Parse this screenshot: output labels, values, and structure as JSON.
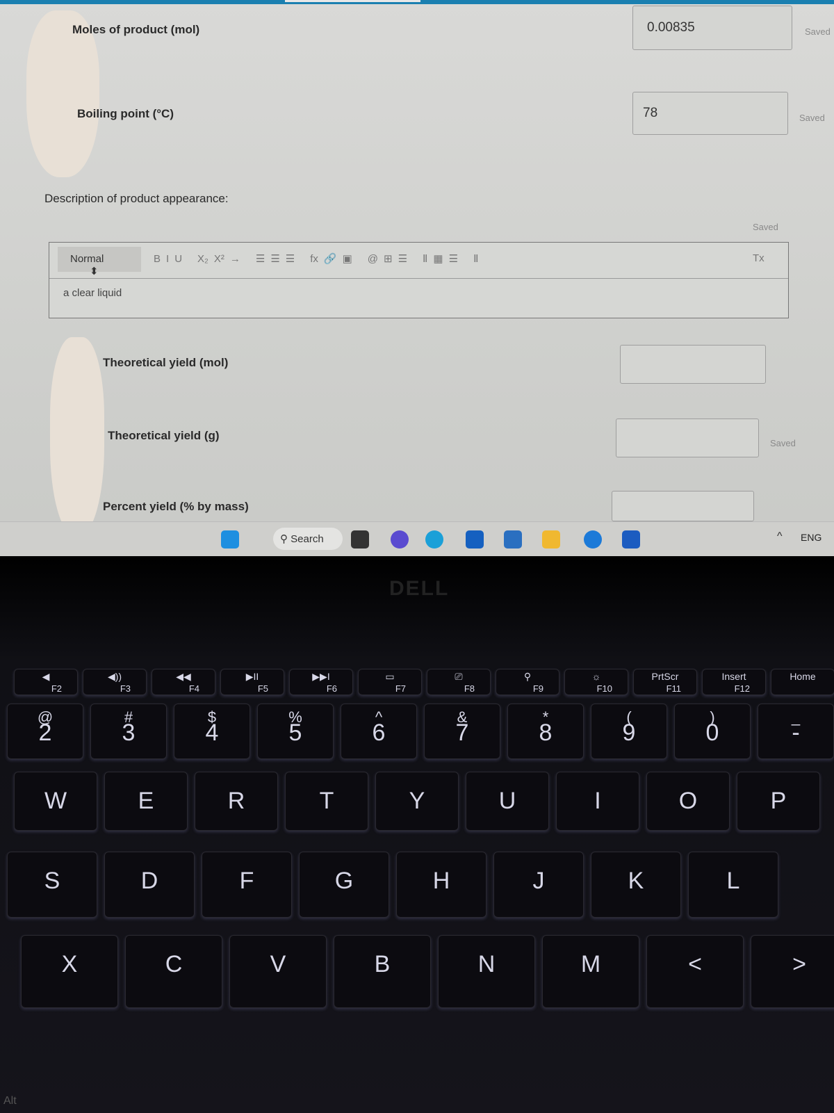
{
  "form": {
    "moles_label": "Moles of product (mol)",
    "moles_value": "0.00835",
    "moles_status": "Saved",
    "bp_label": "Boiling point (°C)",
    "bp_value": "78",
    "bp_status": "Saved",
    "desc_label": "Description of product appearance:",
    "desc_status": "Saved",
    "editor": {
      "style": "Normal",
      "toolbar": [
        "B",
        "I",
        "U",
        "X₂",
        "X²",
        "→",
        "☰",
        "☰",
        "☰",
        "fx",
        "🔗",
        "▣",
        "@",
        "⊞",
        "☰",
        "Ⅱ",
        "▦",
        "☰",
        "Ⅱ"
      ],
      "clear_format": "Tx",
      "content": "a clear liquid"
    },
    "ty_mol_label": "Theoretical yield (mol)",
    "ty_mol_value": "",
    "ty_g_label": "Theoretical yield (g)",
    "ty_g_value": "",
    "ty_g_status": "Saved",
    "pct_label": "Percent yield (% by mass)",
    "pct_value": ""
  },
  "taskbar": {
    "search": "Search",
    "tray_chevron": "^",
    "language": "ENG",
    "apps": [
      "windows",
      "search",
      "files",
      "meet",
      "edge",
      "mail",
      "store",
      "explorer",
      "settings",
      "word"
    ]
  },
  "keyboard": {
    "brand": "DELL",
    "fn_row": [
      [
        "◀",
        "F2"
      ],
      [
        "◀))",
        "F3"
      ],
      [
        "◀◀",
        "F4"
      ],
      [
        "▶II",
        "F5"
      ],
      [
        "▶▶I",
        "F6"
      ],
      [
        "▭",
        "F7"
      ],
      [
        "⎚",
        "F8"
      ],
      [
        "⚲",
        "F9"
      ],
      [
        "☼",
        "F10"
      ],
      [
        "PrtScr",
        "F11"
      ],
      [
        "Insert",
        "F12"
      ],
      [
        "Home",
        ""
      ]
    ],
    "num_row": [
      [
        "@",
        "2"
      ],
      [
        "#",
        "3"
      ],
      [
        "$",
        "4"
      ],
      [
        "%",
        "5"
      ],
      [
        "^",
        "6"
      ],
      [
        "&",
        "7"
      ],
      [
        "*",
        "8"
      ],
      [
        "(",
        "9"
      ],
      [
        ")",
        "0"
      ],
      [
        "_",
        "-"
      ]
    ],
    "row_q": [
      "W",
      "E",
      "R",
      "T",
      "Y",
      "U",
      "I",
      "O",
      "P"
    ],
    "row_a": [
      "S",
      "D",
      "F",
      "G",
      "H",
      "J",
      "K",
      "L"
    ],
    "row_z": [
      "X",
      "C",
      "V",
      "B",
      "N",
      "M",
      "<",
      ">"
    ],
    "alt": "Alt"
  }
}
